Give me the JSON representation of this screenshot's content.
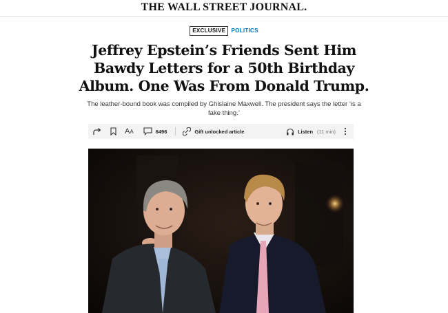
{
  "masthead": {
    "title": "THE WALL STREET JOURNAL."
  },
  "article": {
    "flag": "EXCLUSIVE",
    "section": "POLITICS",
    "headline": "Jeffrey Epstein’s Friends Sent Him Bawdy Letters for a 50th Birthday Album. One Was From Donald Trump.",
    "dek": "The leather-bound book was compiled by Ghislaine Maxwell. The president says the letter ‘is a fake thing.’"
  },
  "toolbar": {
    "comments_count": "6496",
    "gift_label": "Gift unlocked article",
    "listen_label": "Listen",
    "listen_duration": "(11 min)",
    "icons": [
      "share-icon",
      "bookmark-icon",
      "text-size-icon",
      "comment-icon",
      "gift-icon",
      "headphones-icon",
      "more-icon"
    ]
  },
  "photo": {
    "alt_subject": "Two men in suits posing together at night"
  }
}
